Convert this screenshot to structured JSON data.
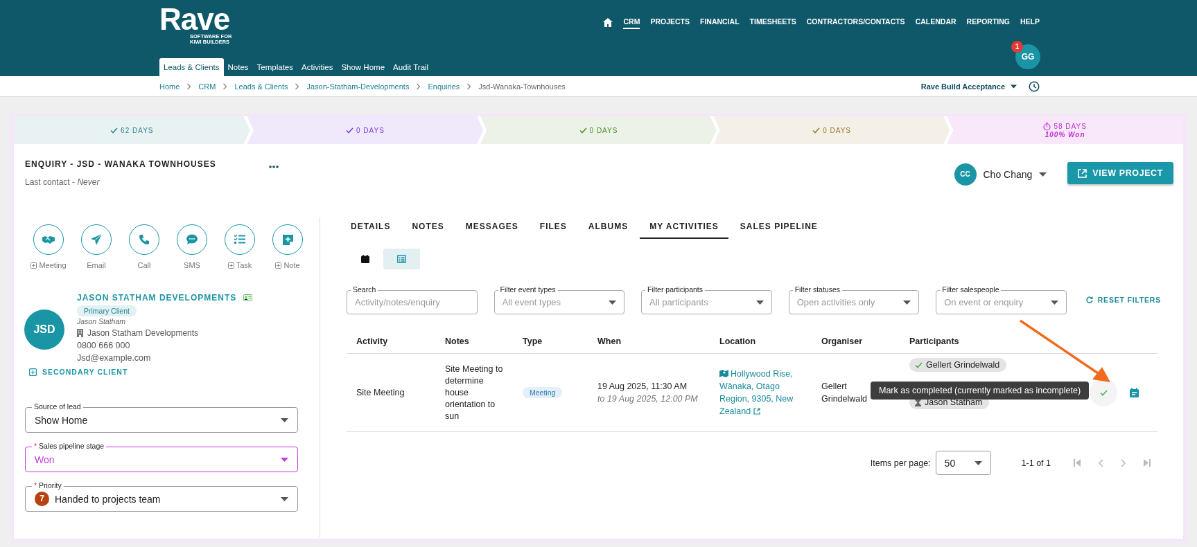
{
  "header": {
    "logo": "Rave",
    "tagline": [
      "SOFTWARE FOR",
      "KIWI BUILDERS"
    ],
    "nav": [
      {
        "label": "CRM",
        "selected": true
      },
      {
        "label": "PROJECTS",
        "selected": false
      },
      {
        "label": "FINANCIAL",
        "selected": false
      },
      {
        "label": "TIMESHEETS",
        "selected": false
      },
      {
        "label": "CONTRACTORS/CONTACTS",
        "selected": false
      },
      {
        "label": "CALENDAR",
        "selected": false
      },
      {
        "label": "REPORTING",
        "selected": false
      },
      {
        "label": "HELP",
        "selected": false
      }
    ],
    "subtabs": [
      {
        "label": "Leads & Clients",
        "selected": true
      },
      {
        "label": "Notes",
        "selected": false
      },
      {
        "label": "Templates",
        "selected": false
      },
      {
        "label": "Activities",
        "selected": false
      },
      {
        "label": "Show Home",
        "selected": false
      },
      {
        "label": "Audit Trail",
        "selected": false
      }
    ],
    "user": {
      "initials": "GG",
      "badge": "1"
    }
  },
  "breadcrumbs": [
    {
      "label": "Home",
      "current": false
    },
    {
      "label": "CRM",
      "current": false
    },
    {
      "label": "Leads & Clients",
      "current": false
    },
    {
      "label": "Jason-Statham-Developments",
      "current": false
    },
    {
      "label": "Enquiries",
      "current": false
    },
    {
      "label": "Jsd-Wanaka-Townhouses",
      "current": true
    }
  ],
  "workspace": {
    "label": "Rave Build Acceptance"
  },
  "pipeline": [
    {
      "kind": "done",
      "label": "62 DAYS",
      "color": "#2a8a8c"
    },
    {
      "kind": "done",
      "label": "0 DAYS",
      "color": "#7a3be0"
    },
    {
      "kind": "done",
      "label": "0 DAYS",
      "color": "#4f8a2c"
    },
    {
      "kind": "done",
      "label": "0 DAYS",
      "color": "#9a7a2a"
    },
    {
      "kind": "current",
      "label": "58 DAYS",
      "note": "100% Won",
      "color": "#c02ed6"
    }
  ],
  "enquiry": {
    "title": "ENQUIRY - JSD - WANAKA TOWNHOUSES",
    "last_contact_label": "Last contact -",
    "last_contact_value": "Never",
    "owner": {
      "initials": "CC",
      "name": "Cho Chang"
    },
    "button": "VIEW PROJECT"
  },
  "actions": [
    {
      "kind": "meeting",
      "label": "Meeting",
      "addable": true
    },
    {
      "kind": "email",
      "label": "Email",
      "addable": false
    },
    {
      "kind": "call",
      "label": "Call",
      "addable": false
    },
    {
      "kind": "sms",
      "label": "SMS",
      "addable": false
    },
    {
      "kind": "task",
      "label": "Task",
      "addable": true
    },
    {
      "kind": "note",
      "label": "Note",
      "addable": true
    }
  ],
  "client": {
    "name": "JASON STATHAM DEVELOPMENTS",
    "initials": "JSD",
    "role": "Primary Client",
    "contact": "Jason Statham",
    "company": "Jason Statham Developments",
    "phone": "0800 666 000",
    "email": "Jsd@example.com",
    "secondary": "SECONDARY CLIENT"
  },
  "lead_fields": [
    {
      "label": "Source of lead",
      "value": "Show Home"
    },
    {
      "required_mark": "*",
      "label": "Sales pipeline stage",
      "value": "Won",
      "color": "#c03ddc"
    },
    {
      "required_mark": "*",
      "label": "Priority",
      "value": "Handed to projects team",
      "badge": "7"
    }
  ],
  "tabs": [
    {
      "label": "DETAILS",
      "selected": false
    },
    {
      "label": "NOTES",
      "selected": false
    },
    {
      "label": "MESSAGES",
      "selected": false
    },
    {
      "label": "FILES",
      "selected": false
    },
    {
      "label": "ALBUMS",
      "selected": false
    },
    {
      "label": "MY ACTIVITIES",
      "selected": true
    },
    {
      "label": "SALES PIPELINE",
      "selected": false
    }
  ],
  "views": [
    {
      "kind": "calendar",
      "selected": false
    },
    {
      "kind": "list",
      "selected": true
    }
  ],
  "filters": [
    {
      "kind": "search",
      "label": "Search",
      "placeholder": "Activity/notes/enquiry"
    },
    {
      "kind": "select",
      "label": "Filter event types",
      "value": "All event types"
    },
    {
      "kind": "select",
      "label": "Filter participants",
      "value": "All participants"
    },
    {
      "kind": "select",
      "label": "Filter statuses",
      "value": "Open activities only"
    },
    {
      "kind": "select",
      "label": "Filter salespeople",
      "value": "On event or enquiry"
    }
  ],
  "reset_filters": "RESET FILTERS",
  "table": {
    "columns": [
      "Activity",
      "Notes",
      "Type",
      "When",
      "Location",
      "Organiser",
      "Participants"
    ],
    "rows": [
      {
        "activity": "Site Meeting",
        "notes": "Site Meeting to determine house orientation to sun",
        "type": "Meeting",
        "when": "19 Aug 2025, 11:30 AM",
        "until": "to 19 Aug 2025, 12:00 PM",
        "location": "Hollywood Rise, Wānaka, Otago Region, 9305, New Zealand",
        "organiser": "Gellert Grindelwald",
        "participants": [
          {
            "name": "Gellert Grindelwald",
            "accepted": true
          },
          {
            "name": "Jason Statham",
            "accepted": false
          }
        ],
        "completed": false
      }
    ]
  },
  "tooltip": "Mark as completed (currently marked as incomplete)",
  "pagination": {
    "label": "Items per page:",
    "per_page": "50",
    "range": "1-1 of 1",
    "buttons": [
      {
        "kind": "first",
        "disabled": true
      },
      {
        "kind": "previous",
        "disabled": true
      },
      {
        "kind": "next",
        "disabled": true
      },
      {
        "kind": "last",
        "disabled": true
      }
    ]
  }
}
